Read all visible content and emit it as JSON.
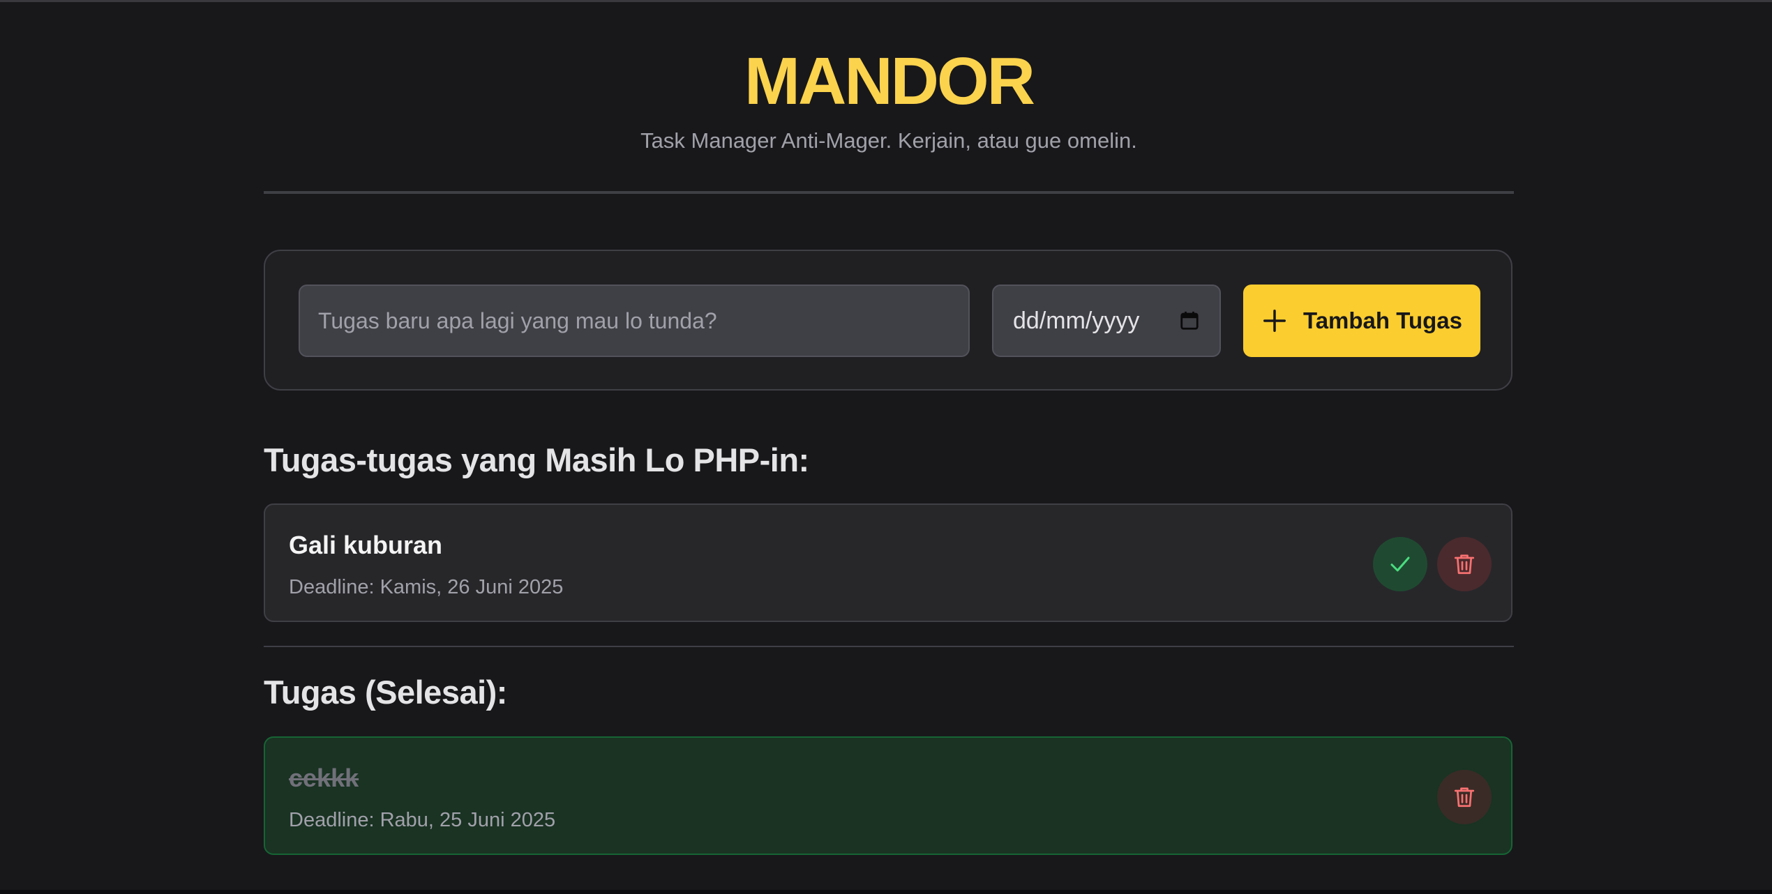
{
  "app": {
    "title": "MANDOR",
    "subtitle": "Task Manager Anti-Mager. Kerjain, atau gue omelin."
  },
  "form": {
    "task_placeholder": "Tugas baru apa lagi yang mau lo tunda?",
    "date_placeholder": "dd/mm/yyyy",
    "add_label": "Tambah Tugas"
  },
  "pending": {
    "heading": "Tugas-tugas yang Masih Lo PHP-in:",
    "tasks": [
      {
        "name": "Gali kuburan",
        "deadline": "Deadline: Kamis, 26 Juni 2025"
      }
    ]
  },
  "completed": {
    "heading": "Tugas (Selesai):",
    "tasks": [
      {
        "name": "cekkk",
        "deadline": "Deadline: Rabu, 25 Juni 2025"
      }
    ]
  },
  "icons": {
    "add": "plus-icon",
    "calendar": "calendar-icon",
    "complete": "check-icon",
    "delete": "trash-icon"
  },
  "colors": {
    "accent": "#fcd34d",
    "button": "#fbcd2f",
    "success": "#4ade80",
    "danger": "#f87171"
  }
}
